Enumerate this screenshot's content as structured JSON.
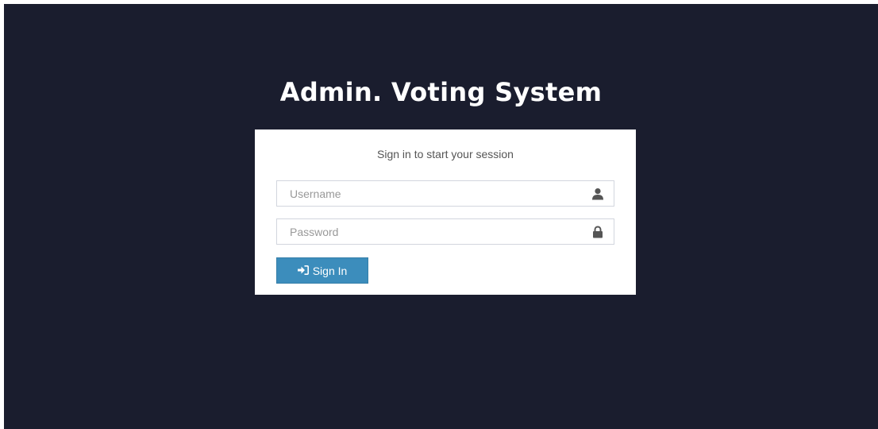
{
  "page": {
    "title": "Admin. Voting System",
    "background_color": "#1a1d2e"
  },
  "login": {
    "message": "Sign in to start your session",
    "username": {
      "placeholder": "Username",
      "value": "",
      "icon": "user-icon"
    },
    "password": {
      "placeholder": "Password",
      "value": "",
      "icon": "lock-icon"
    },
    "submit": {
      "label": "Sign In",
      "icon": "sign-in-icon",
      "color": "#3c8dbc"
    }
  }
}
